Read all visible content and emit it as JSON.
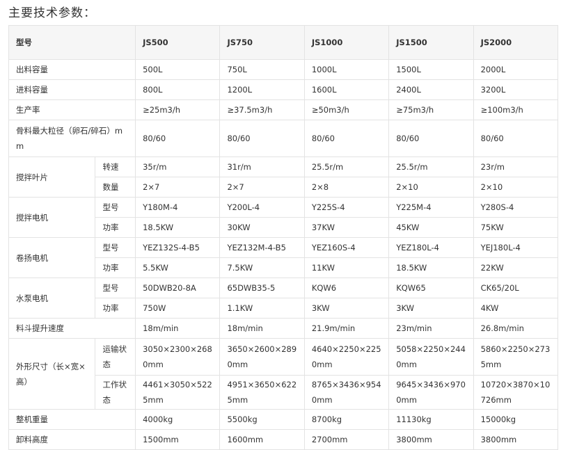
{
  "heading": "主要技术参数：",
  "header": {
    "model_label": "型号",
    "models": [
      "JS500",
      "JS750",
      "JS1000",
      "JS1500",
      "JS2000"
    ]
  },
  "rows": {
    "output_capacity": {
      "label": "出料容量",
      "values": [
        "500L",
        "750L",
        "1000L",
        "1500L",
        "2000L"
      ]
    },
    "input_capacity": {
      "label": "进料容量",
      "values": [
        "800L",
        "1200L",
        "1600L",
        "2400L",
        "3200L"
      ]
    },
    "productivity": {
      "label": "生产率",
      "values": [
        "≥25m3/h",
        "≥37.5m3/h",
        "≥50m3/h",
        "≥75m3/h",
        "≥100m3/h"
      ]
    },
    "max_aggregate": {
      "label": "骨料最大粒径（卵石/碎石）mm",
      "values": [
        "80/60",
        "80/60",
        "80/60",
        "80/60",
        "80/60"
      ]
    },
    "blade": {
      "label": "搅拌叶片",
      "speed": {
        "label": "转速",
        "values": [
          "35r/m",
          "31r/m",
          "25.5r/m",
          "25.5r/m",
          "23r/m"
        ]
      },
      "count": {
        "label": "数量",
        "values": [
          "2×7",
          "2×7",
          "2×8",
          "2×10",
          "2×10"
        ]
      }
    },
    "mix_motor": {
      "label": "搅拌电机",
      "model": {
        "label": "型号",
        "values": [
          "Y180M-4",
          "Y200L-4",
          "Y225S-4",
          "Y225M-4",
          "Y280S-4"
        ]
      },
      "power": {
        "label": "功率",
        "values": [
          "18.5KW",
          "30KW",
          "37KW",
          "45KW",
          "75KW"
        ]
      }
    },
    "hoist_motor": {
      "label": "卷扬电机",
      "model": {
        "label": "型号",
        "values": [
          "YEZ132S-4-B5",
          "YEZ132M-4-B5",
          "YEZ160S-4",
          "YEZ180L-4",
          "YEJ180L-4"
        ]
      },
      "power": {
        "label": "功率",
        "values": [
          "5.5KW",
          "7.5KW",
          "11KW",
          "18.5KW",
          "22KW"
        ]
      }
    },
    "pump_motor": {
      "label": "水泵电机",
      "model": {
        "label": "型号",
        "values": [
          "50DWB20-8A",
          "65DWB35-5",
          "KQW6",
          "KQW65",
          "CK65/20L"
        ]
      },
      "power": {
        "label": "功率",
        "values": [
          "750W",
          "1.1KW",
          "3KW",
          "3KW",
          "4KW"
        ]
      }
    },
    "hopper_speed": {
      "label": "料斗提升速度",
      "values": [
        "18m/min",
        "18m/min",
        "21.9m/min",
        "23m/min",
        "26.8m/min"
      ]
    },
    "dimensions": {
      "label": "外形尺寸（长×宽×高）",
      "transport": {
        "label": "运输状态",
        "values": [
          "3050×2300×2680mm",
          "3650×2600×2890mm",
          "4640×2250×2250mm",
          "5058×2250×2440mm",
          "5860×2250×2735mm"
        ]
      },
      "working": {
        "label": "工作状态",
        "values": [
          "4461×3050×5225mm",
          "4951×3650×6225mm",
          "8765×3436×9540mm",
          "9645×3436×9700mm",
          "10720×3870×10726mm"
        ]
      }
    },
    "weight": {
      "label": "整机重量",
      "values": [
        "4000kg",
        "5500kg",
        "8700kg",
        "11130kg",
        "15000kg"
      ]
    },
    "discharge_height": {
      "label": "卸料高度",
      "values": [
        "1500mm",
        "1600mm",
        "2700mm",
        "3800mm",
        "3800mm"
      ]
    }
  }
}
